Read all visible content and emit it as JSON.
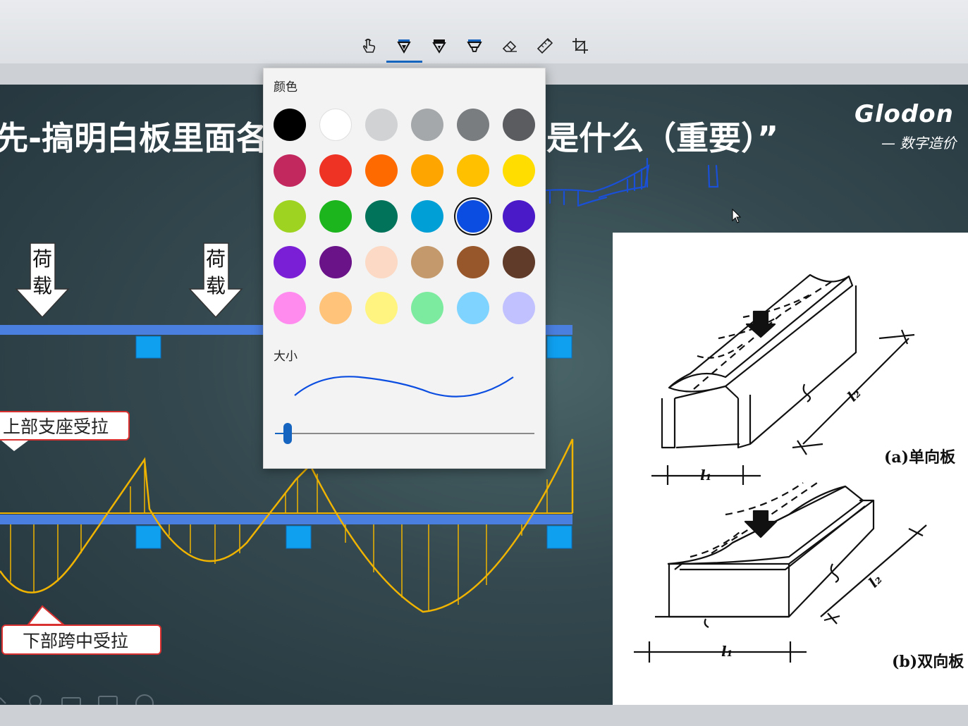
{
  "toolbar": {
    "tools": [
      {
        "name": "touch-writing",
        "icon": "touch-hand-icon"
      },
      {
        "name": "ballpoint-pen",
        "icon": "ballpoint-pen-icon",
        "selected": true
      },
      {
        "name": "pencil",
        "icon": "pencil-icon"
      },
      {
        "name": "highlighter",
        "icon": "highlighter-icon"
      },
      {
        "name": "eraser",
        "icon": "eraser-icon"
      },
      {
        "name": "ruler",
        "icon": "ruler-icon"
      },
      {
        "name": "crop",
        "icon": "crop-icon"
      }
    ],
    "accent": "#1565c0"
  },
  "pen_popup": {
    "color_heading": "颜色",
    "size_heading": "大小",
    "colors": [
      "#000000",
      "#ffffff",
      "#d0d2d3",
      "#a5a8aa",
      "#7a7d80",
      "#5a5c5f",
      "#c2285e",
      "#ee3224",
      "#ff6a00",
      "#ffa500",
      "#ffc000",
      "#ffdd00",
      "#9fd322",
      "#1db51d",
      "#00735a",
      "#00a0d6",
      "#0a4de0",
      "#4a19c8",
      "#7a1fd6",
      "#6a1389",
      "#fbd9c4",
      "#c49a6c",
      "#98572a",
      "#603b2a",
      "#ff8bef",
      "#ffc37a",
      "#fff47f",
      "#7deb9f",
      "#7fd4ff",
      "#c1c1ff"
    ],
    "selected_color_index": 16,
    "size_level": 0.05
  },
  "slide": {
    "title_left": "先-搞明白板里面各",
    "title_right": "是什么（重要）”",
    "brand_logo": "Glodon",
    "brand_tagline": "— 数字造价",
    "load_labels": [
      {
        "text": "荷\n载",
        "chars": [
          "荷",
          "载"
        ]
      },
      {
        "text": "荷\n载",
        "chars": [
          "荷",
          "载"
        ]
      }
    ],
    "callout_top": "上部支座受拉",
    "callout_bottom": "下部跨中受拉",
    "figure_a_label": "(a)单向板",
    "figure_b_label": "(b)双向板",
    "dimension_labels": [
      "l₁",
      "l₂",
      "l₁",
      "l₂"
    ],
    "colors": {
      "beam": "#4a7fe0",
      "support": "#0fa0f0",
      "moment_curve": "#f0b400",
      "ink": "#1a4fd8"
    }
  }
}
